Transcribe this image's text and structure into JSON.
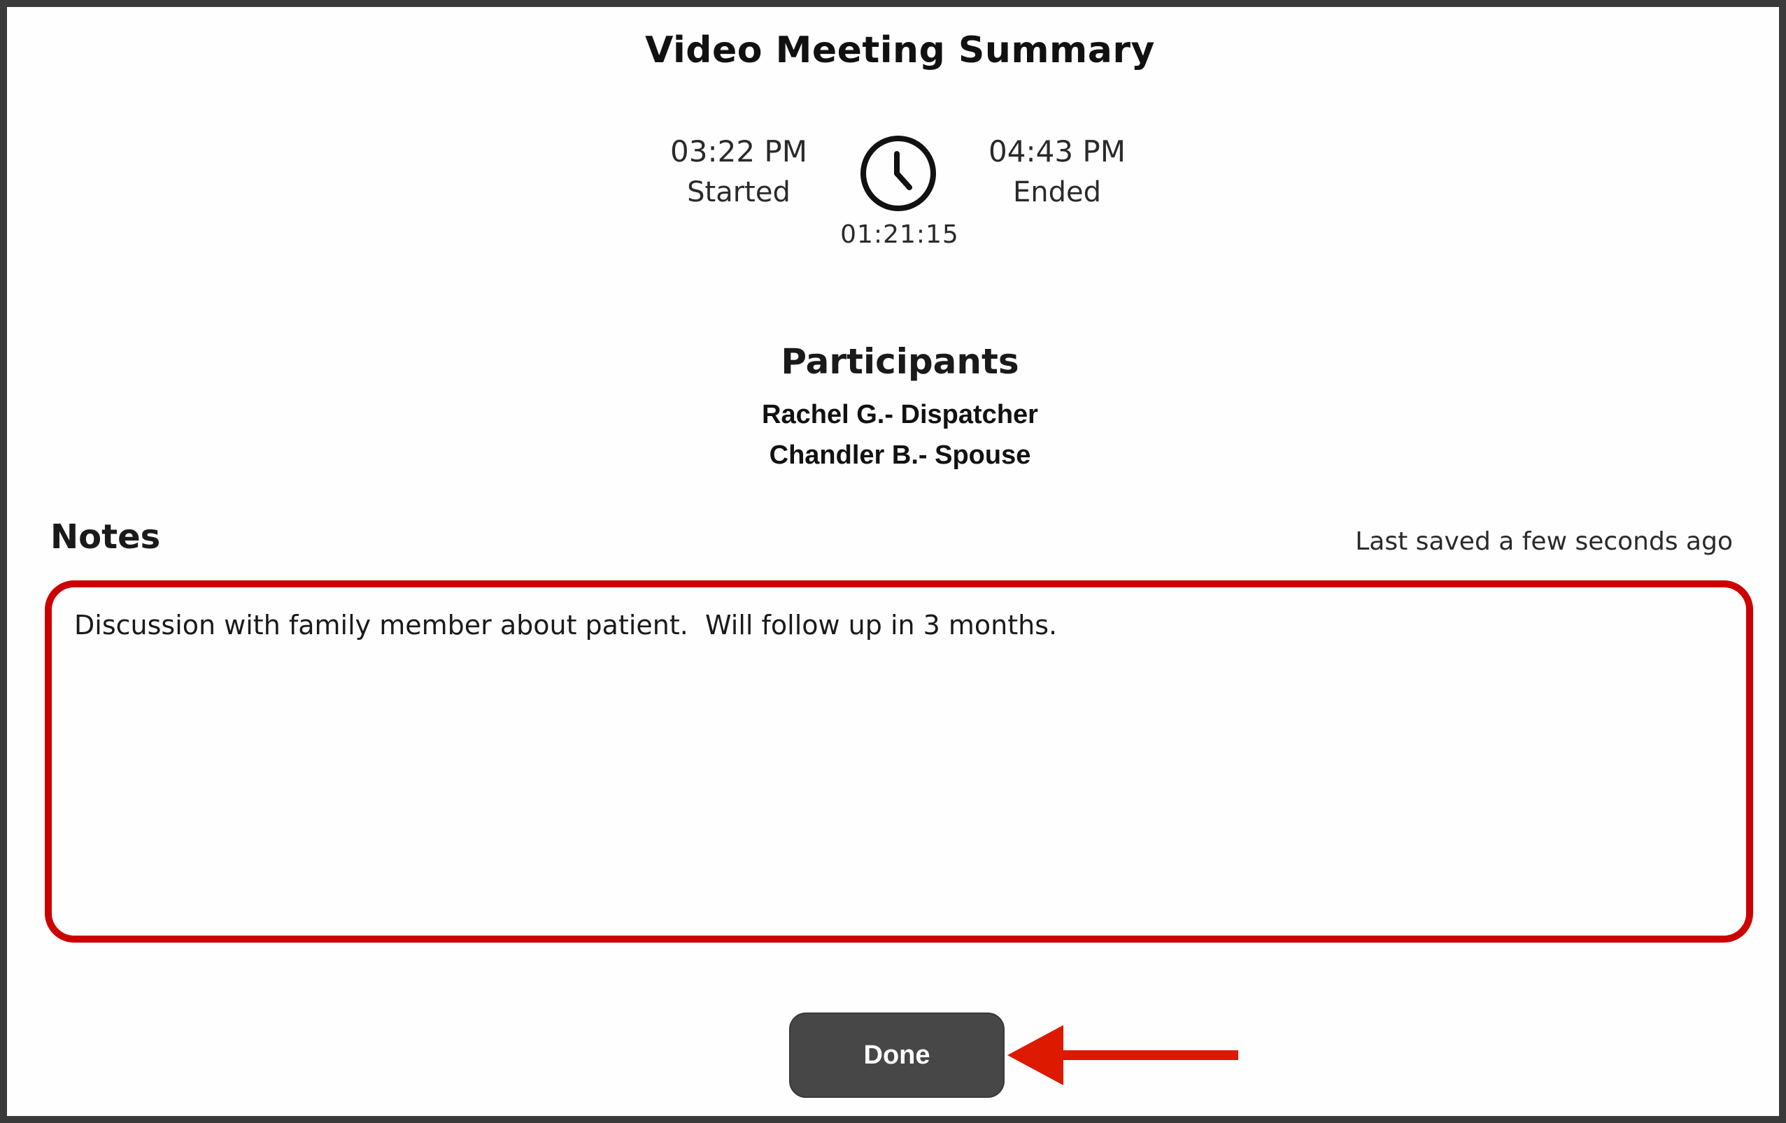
{
  "dialog": {
    "title": "Video Meeting Summary"
  },
  "meeting": {
    "start_time": "03:22 PM",
    "start_label": "Started",
    "end_time": "04:43 PM",
    "end_label": "Ended",
    "duration": "01:21:15",
    "clock_icon": "clock-icon"
  },
  "participants": {
    "title": "Participants",
    "list": [
      "Rachel G.- Dispatcher",
      "Chandler B.- Spouse"
    ]
  },
  "notes": {
    "label": "Notes",
    "saved_status": "Last saved a few seconds ago",
    "value": "Discussion with family member about patient.  Will follow up in 3 months."
  },
  "actions": {
    "done_label": "Done"
  },
  "annotations": {
    "highlight_color": "#cc0000",
    "arrow_color": "#dd1a00",
    "arrow_icon": "arrow-left-icon"
  },
  "colors": {
    "button_bg": "#474747",
    "frame": "#3a3a3a"
  }
}
